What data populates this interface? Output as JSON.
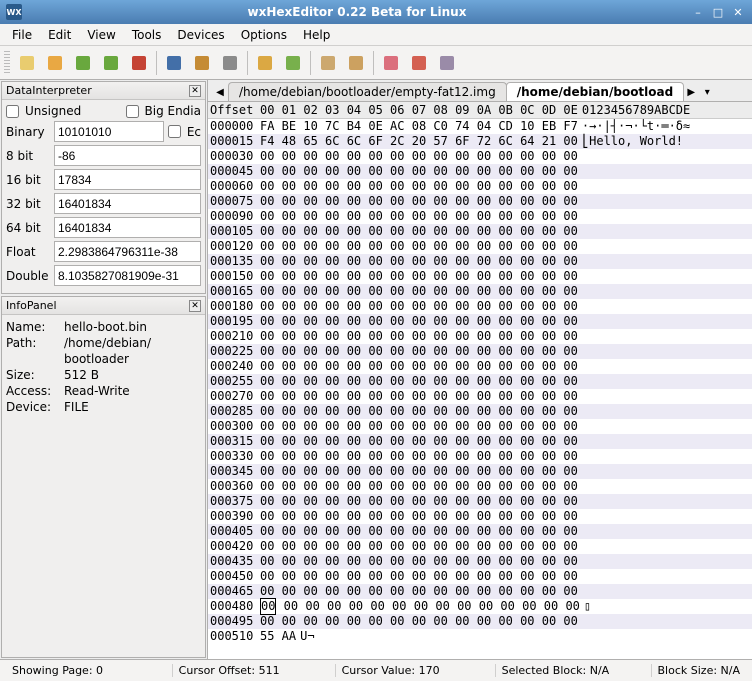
{
  "window": {
    "title": "wxHexEditor 0.22 Beta for Linux",
    "icon_text": "WX"
  },
  "menu": [
    "File",
    "Edit",
    "View",
    "Tools",
    "Devices",
    "Options",
    "Help"
  ],
  "toolbar_icons": [
    "new-file-icon",
    "open-file-icon",
    "save-icon",
    "save-as-icon",
    "record-icon",
    "SEP",
    "find-icon",
    "find-replace-icon",
    "goto-icon",
    "SEP",
    "undo-icon",
    "redo-icon",
    "SEP",
    "copy-icon",
    "paste-icon",
    "SEP",
    "cut-icon",
    "delete-icon",
    "insert-icon"
  ],
  "data_interpreter": {
    "title": "DataInterpreter",
    "unsigned_label": "Unsigned",
    "big_endian_label": "Big Endia",
    "edit_label": "Ec",
    "binary_label": "Binary",
    "binary_value": "10101010",
    "fields": [
      {
        "label": "8 bit",
        "value": "-86"
      },
      {
        "label": "16 bit",
        "value": "17834"
      },
      {
        "label": "32 bit",
        "value": "16401834"
      },
      {
        "label": "64 bit",
        "value": "16401834"
      },
      {
        "label": "Float",
        "value": "2.2983864796311e-38"
      },
      {
        "label": "Double",
        "value": "8.1035827081909e-31"
      }
    ]
  },
  "info_panel": {
    "title": "InfoPanel",
    "rows": [
      {
        "k": "Name:",
        "v": "hello-boot.bin"
      },
      {
        "k": "Path:",
        "v": "/home/debian/"
      },
      {
        "k": "",
        "v": "bootloader"
      },
      {
        "k": "Size:",
        "v": "512 B"
      },
      {
        "k": "Access:",
        "v": "Read-Write"
      },
      {
        "k": "Device:",
        "v": "FILE"
      }
    ]
  },
  "tabs": {
    "inactive": "/home/debian/bootloader/empty-fat12.img",
    "active": "/home/debian/bootload"
  },
  "hex_header": {
    "offset": "Offset",
    "cols": "00 01 02 03 04 05 06 07 08 09 0A 0B 0C 0D 0E",
    "ascii": "0123456789ABCDE"
  },
  "hex_rows": [
    {
      "o": "000000",
      "b": "FA BE 10 7C B4 0E AC 08 C0 74 04 CD 10 EB F7",
      "a": "·→·|┤·¬·└t·═·δ≈"
    },
    {
      "o": "000015",
      "b": "F4 48 65 6C 6C 6F 2C 20 57 6F 72 6C 64 21 00",
      "a": "⎣Hello, World!"
    },
    {
      "o": "000030",
      "b": "00 00 00 00 00 00 00 00 00 00 00 00 00 00 00",
      "a": ""
    },
    {
      "o": "000045",
      "b": "00 00 00 00 00 00 00 00 00 00 00 00 00 00 00",
      "a": ""
    },
    {
      "o": "000060",
      "b": "00 00 00 00 00 00 00 00 00 00 00 00 00 00 00",
      "a": ""
    },
    {
      "o": "000075",
      "b": "00 00 00 00 00 00 00 00 00 00 00 00 00 00 00",
      "a": ""
    },
    {
      "o": "000090",
      "b": "00 00 00 00 00 00 00 00 00 00 00 00 00 00 00",
      "a": ""
    },
    {
      "o": "000105",
      "b": "00 00 00 00 00 00 00 00 00 00 00 00 00 00 00",
      "a": ""
    },
    {
      "o": "000120",
      "b": "00 00 00 00 00 00 00 00 00 00 00 00 00 00 00",
      "a": ""
    },
    {
      "o": "000135",
      "b": "00 00 00 00 00 00 00 00 00 00 00 00 00 00 00",
      "a": ""
    },
    {
      "o": "000150",
      "b": "00 00 00 00 00 00 00 00 00 00 00 00 00 00 00",
      "a": ""
    },
    {
      "o": "000165",
      "b": "00 00 00 00 00 00 00 00 00 00 00 00 00 00 00",
      "a": ""
    },
    {
      "o": "000180",
      "b": "00 00 00 00 00 00 00 00 00 00 00 00 00 00 00",
      "a": ""
    },
    {
      "o": "000195",
      "b": "00 00 00 00 00 00 00 00 00 00 00 00 00 00 00",
      "a": ""
    },
    {
      "o": "000210",
      "b": "00 00 00 00 00 00 00 00 00 00 00 00 00 00 00",
      "a": ""
    },
    {
      "o": "000225",
      "b": "00 00 00 00 00 00 00 00 00 00 00 00 00 00 00",
      "a": ""
    },
    {
      "o": "000240",
      "b": "00 00 00 00 00 00 00 00 00 00 00 00 00 00 00",
      "a": ""
    },
    {
      "o": "000255",
      "b": "00 00 00 00 00 00 00 00 00 00 00 00 00 00 00",
      "a": ""
    },
    {
      "o": "000270",
      "b": "00 00 00 00 00 00 00 00 00 00 00 00 00 00 00",
      "a": ""
    },
    {
      "o": "000285",
      "b": "00 00 00 00 00 00 00 00 00 00 00 00 00 00 00",
      "a": ""
    },
    {
      "o": "000300",
      "b": "00 00 00 00 00 00 00 00 00 00 00 00 00 00 00",
      "a": ""
    },
    {
      "o": "000315",
      "b": "00 00 00 00 00 00 00 00 00 00 00 00 00 00 00",
      "a": ""
    },
    {
      "o": "000330",
      "b": "00 00 00 00 00 00 00 00 00 00 00 00 00 00 00",
      "a": ""
    },
    {
      "o": "000345",
      "b": "00 00 00 00 00 00 00 00 00 00 00 00 00 00 00",
      "a": ""
    },
    {
      "o": "000360",
      "b": "00 00 00 00 00 00 00 00 00 00 00 00 00 00 00",
      "a": ""
    },
    {
      "o": "000375",
      "b": "00 00 00 00 00 00 00 00 00 00 00 00 00 00 00",
      "a": ""
    },
    {
      "o": "000390",
      "b": "00 00 00 00 00 00 00 00 00 00 00 00 00 00 00",
      "a": ""
    },
    {
      "o": "000405",
      "b": "00 00 00 00 00 00 00 00 00 00 00 00 00 00 00",
      "a": ""
    },
    {
      "o": "000420",
      "b": "00 00 00 00 00 00 00 00 00 00 00 00 00 00 00",
      "a": ""
    },
    {
      "o": "000435",
      "b": "00 00 00 00 00 00 00 00 00 00 00 00 00 00 00",
      "a": ""
    },
    {
      "o": "000450",
      "b": "00 00 00 00 00 00 00 00 00 00 00 00 00 00 00",
      "a": ""
    },
    {
      "o": "000465",
      "b": "00 00 00 00 00 00 00 00 00 00 00 00 00 00 00",
      "a": ""
    },
    {
      "o": "000480",
      "b": "00 00 00 00 00 00 00 00 00 00 00 00 00 00 00",
      "a": "▯",
      "sel": true
    },
    {
      "o": "000495",
      "b": "00 00 00 00 00 00 00 00 00 00 00 00 00 00 00",
      "a": ""
    },
    {
      "o": "000510",
      "b": "55 AA",
      "a": "U¬"
    }
  ],
  "status": {
    "page": "Showing Page: 0",
    "cursor_offset": "Cursor Offset: 511",
    "cursor_value": "Cursor Value: 170",
    "selected_block": "Selected Block: N/A",
    "block_size": "Block Size: N/A"
  }
}
